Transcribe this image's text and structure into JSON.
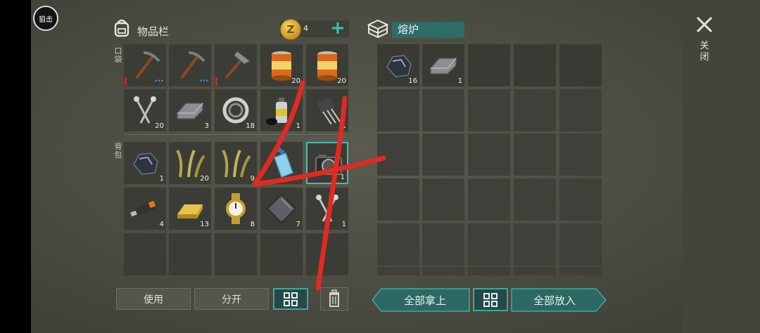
{
  "top": {
    "sniper_label": "狙击"
  },
  "inventory": {
    "title": "物品栏",
    "coins": "4",
    "pocket_label": "口袋",
    "backpack_label": "背包",
    "pocket": [
      {
        "item": "pickaxe",
        "count": "",
        "bar": true,
        "dots": "•••"
      },
      {
        "item": "pickaxe",
        "count": "",
        "bar": false,
        "dots": "•••"
      },
      {
        "item": "pickaxe-iron",
        "count": "",
        "bar": true,
        "dots": ""
      },
      {
        "item": "canned-food",
        "count": "20"
      },
      {
        "item": "canned-food",
        "count": "20"
      },
      {
        "item": "nails",
        "count": "20"
      },
      {
        "item": "iron-bar",
        "count": "3"
      },
      {
        "item": "bearing",
        "count": "18"
      },
      {
        "item": "spray-paint",
        "count": "1"
      },
      {
        "item": "transistor",
        "count": "1"
      }
    ],
    "backpack": [
      {
        "item": "coal",
        "count": "1"
      },
      {
        "item": "grass",
        "count": "20"
      },
      {
        "item": "grass",
        "count": "9"
      },
      {
        "item": "water-bottle",
        "count": ""
      },
      {
        "item": "camera",
        "count": "1",
        "selected": true
      },
      {
        "item": "usb-stick",
        "count": "4"
      },
      {
        "item": "gold-bar",
        "count": "13"
      },
      {
        "item": "wristwatch",
        "count": "8"
      },
      {
        "item": "steel-plate",
        "count": "7"
      },
      {
        "item": "nails",
        "count": "1"
      },
      {
        "item": "",
        "count": ""
      },
      {
        "item": "",
        "count": ""
      },
      {
        "item": "",
        "count": ""
      },
      {
        "item": "",
        "count": ""
      },
      {
        "item": "",
        "count": ""
      }
    ],
    "buttons": {
      "use": "使用",
      "split": "分开"
    }
  },
  "furnace": {
    "title": "熔炉",
    "slots_top": [
      {
        "item": "coal",
        "count": "16"
      },
      {
        "item": "iron-bar",
        "count": "1"
      }
    ],
    "buttons": {
      "take_all": "全部拿上",
      "put_all": "全部放入"
    }
  },
  "close": {
    "label": "关闭"
  },
  "overlay": {
    "handwriting": "4"
  },
  "colors": {
    "accent": "#4fb8b0",
    "scribble": "#e02a22"
  }
}
